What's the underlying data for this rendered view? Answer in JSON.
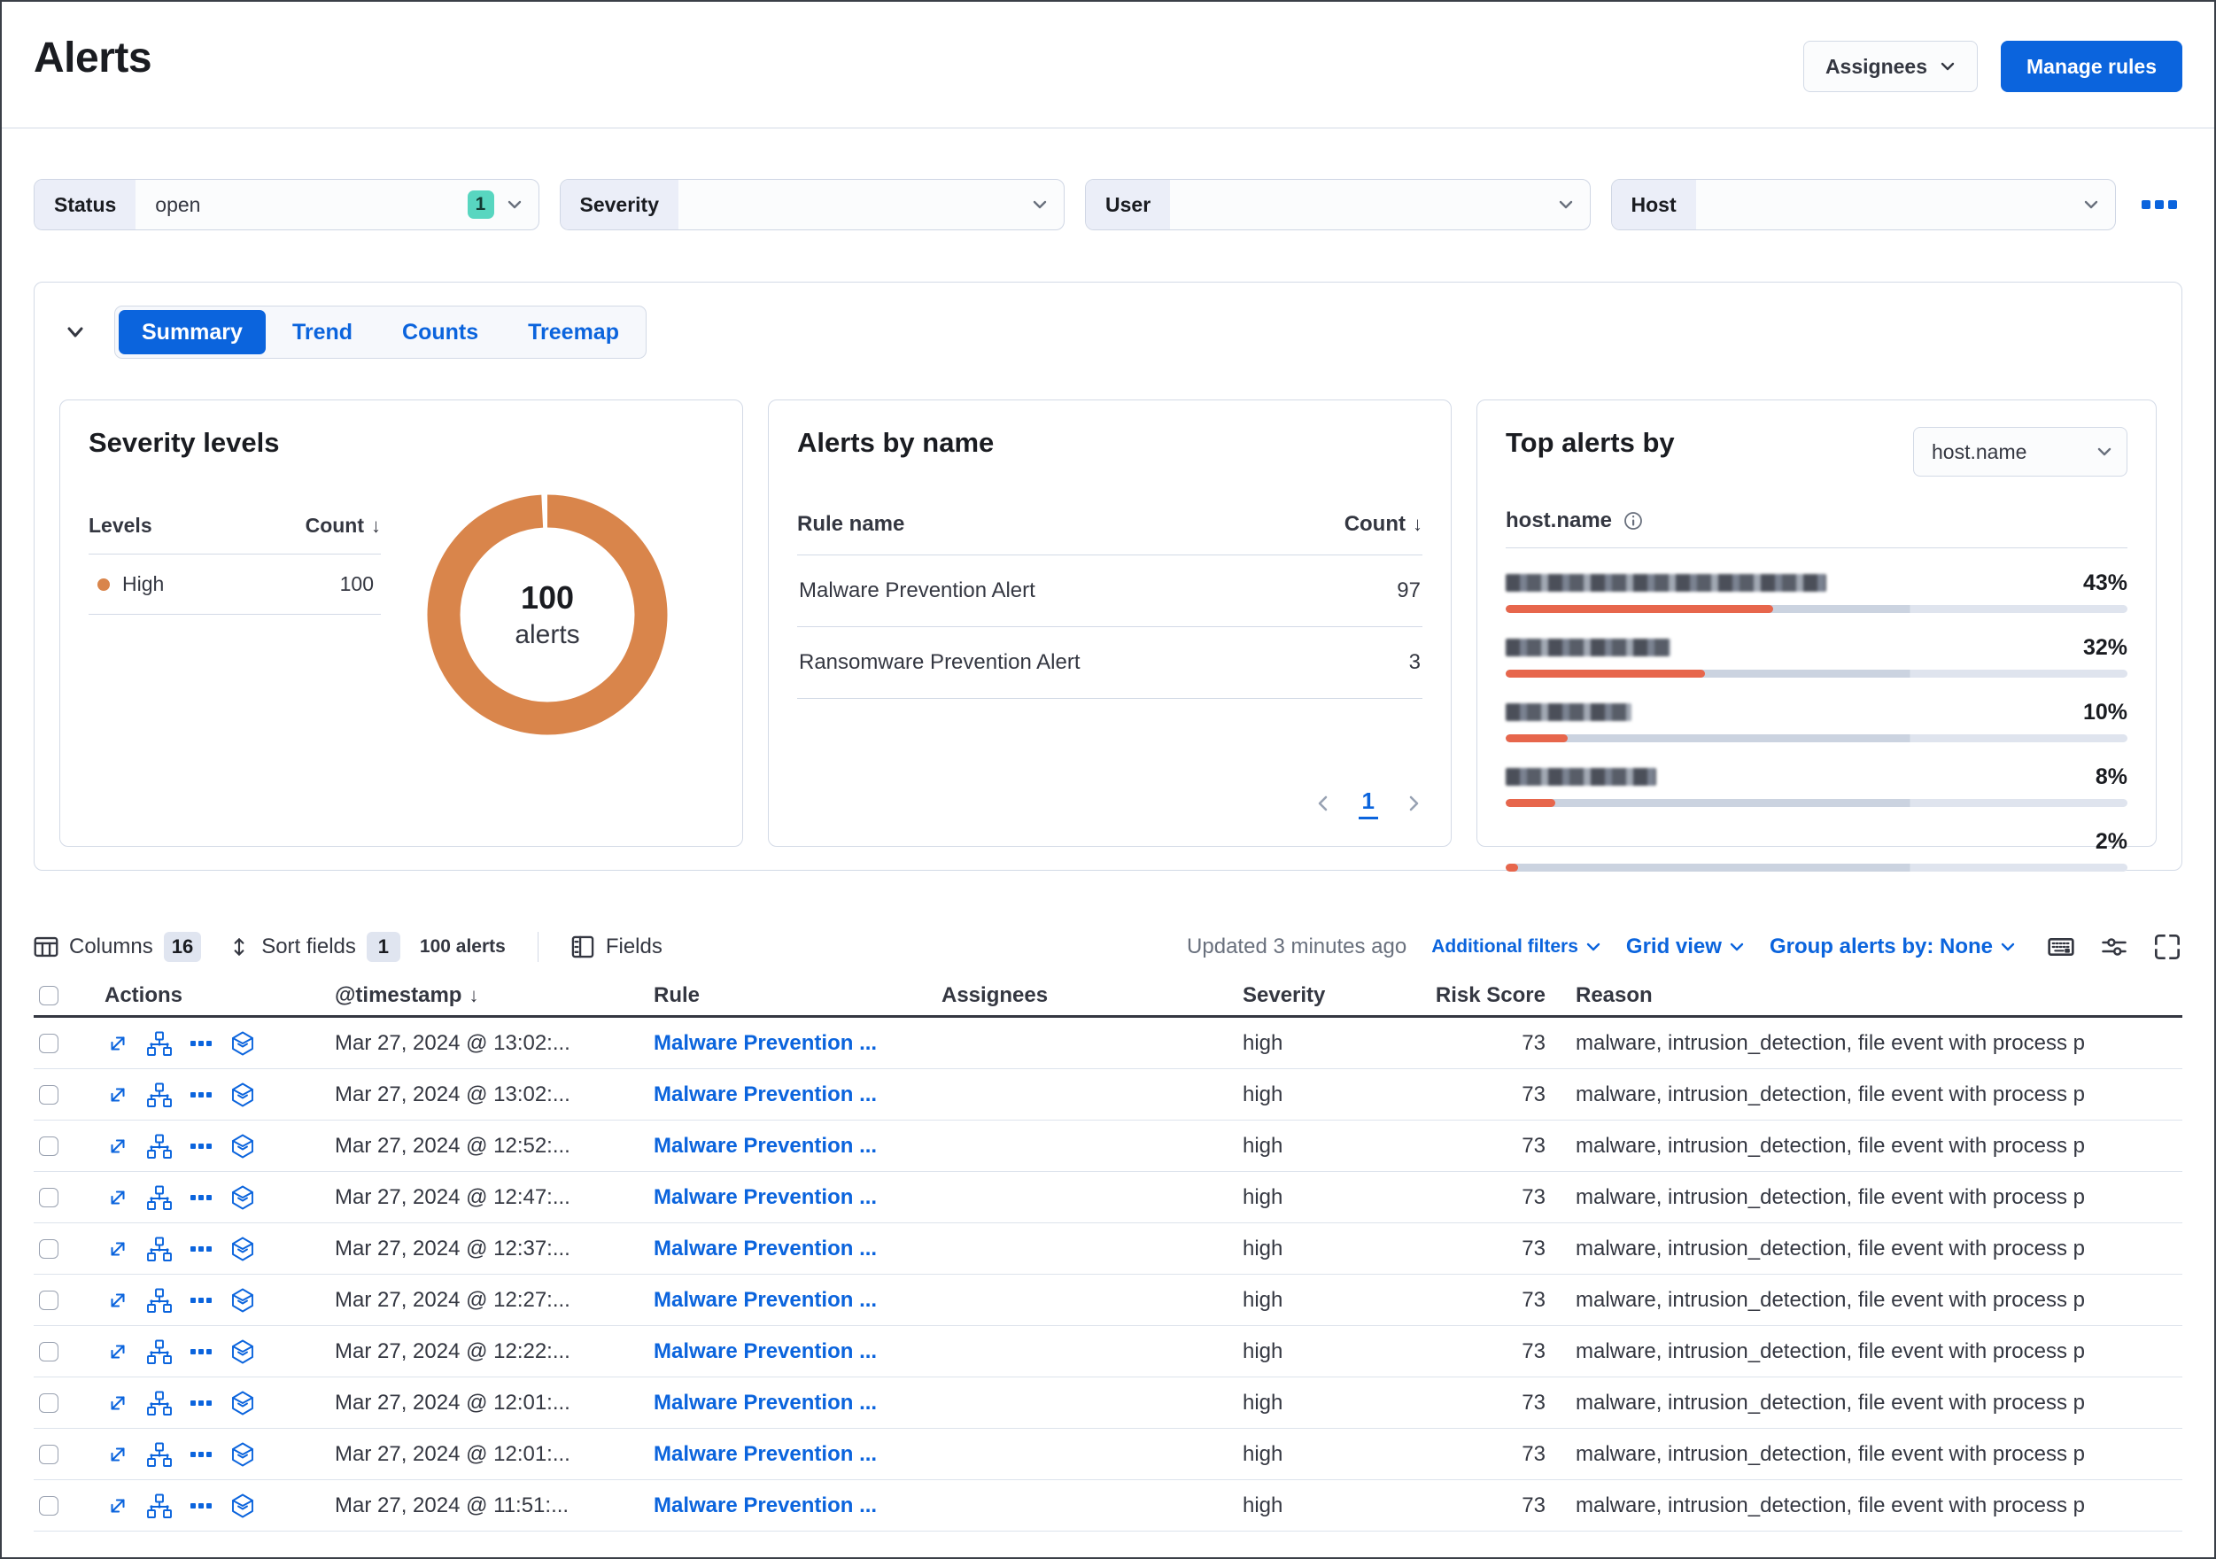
{
  "page": {
    "title": "Alerts"
  },
  "header": {
    "assignees_button": "Assignees",
    "manage_rules_button": "Manage rules"
  },
  "filters": {
    "status": {
      "label": "Status",
      "value": "open",
      "badge": "1"
    },
    "severity": {
      "label": "Severity",
      "value": ""
    },
    "user": {
      "label": "User",
      "value": ""
    },
    "host": {
      "label": "Host",
      "value": ""
    }
  },
  "kpi_tabs": {
    "summary": "Summary",
    "trend": "Trend",
    "counts": "Counts",
    "treemap": "Treemap"
  },
  "icons": {
    "sort_arrow": "↓"
  },
  "severity_panel": {
    "title": "Severity levels",
    "col_levels": "Levels",
    "col_count": "Count",
    "rows": [
      {
        "level": "High",
        "count": "100",
        "color": "#d9854b"
      }
    ],
    "donut": {
      "total": "100",
      "label": "alerts",
      "color": "#d9854b"
    }
  },
  "alerts_by_name_panel": {
    "title": "Alerts by name",
    "col_rule": "Rule name",
    "col_count": "Count",
    "rows": [
      {
        "rule": "Malware Prevention Alert",
        "count": "97"
      },
      {
        "rule": "Ransomware Prevention Alert",
        "count": "3"
      }
    ],
    "pagination": {
      "page": "1"
    }
  },
  "top_alerts_panel": {
    "title": "Top alerts by",
    "selector_value": "host.name",
    "field_label": "host.name",
    "bar_color": "#e7664c",
    "rows": [
      {
        "name": "[redacted host name]",
        "pct": "43%",
        "pct_value": 43
      },
      {
        "name": "[redacted host name]",
        "pct": "32%",
        "pct_value": 32
      },
      {
        "name": "[redacted host name]",
        "pct": "10%",
        "pct_value": 10
      },
      {
        "name": "[redacted host name]",
        "pct": "8%",
        "pct_value": 8
      },
      {
        "name": "[redacted host name]",
        "pct": "2%",
        "pct_value": 2
      }
    ]
  },
  "table_toolbar": {
    "columns_label": "Columns",
    "columns_count": "16",
    "sort_label": "Sort fields",
    "sort_count": "1",
    "alerts_count": "100 alerts",
    "fields_label": "Fields",
    "updated": "Updated 3 minutes ago",
    "additional_filters": "Additional filters",
    "grid_view": "Grid view",
    "group_by": "Group alerts by: None"
  },
  "table": {
    "headers": {
      "actions": "Actions",
      "timestamp": "@timestamp",
      "rule": "Rule",
      "assignees": "Assignees",
      "severity": "Severity",
      "risk_score": "Risk Score",
      "reason": "Reason"
    },
    "rows": [
      {
        "timestamp": "Mar 27, 2024 @ 13:02:...",
        "rule": "Malware Prevention ...",
        "assignees": "",
        "severity": "high",
        "risk": "73",
        "reason": "malware, intrusion_detection, file event with process p"
      },
      {
        "timestamp": "Mar 27, 2024 @ 13:02:...",
        "rule": "Malware Prevention ...",
        "assignees": "",
        "severity": "high",
        "risk": "73",
        "reason": "malware, intrusion_detection, file event with process p"
      },
      {
        "timestamp": "Mar 27, 2024 @ 12:52:...",
        "rule": "Malware Prevention ...",
        "assignees": "",
        "severity": "high",
        "risk": "73",
        "reason": "malware, intrusion_detection, file event with process p"
      },
      {
        "timestamp": "Mar 27, 2024 @ 12:47:...",
        "rule": "Malware Prevention ...",
        "assignees": "",
        "severity": "high",
        "risk": "73",
        "reason": "malware, intrusion_detection, file event with process p"
      },
      {
        "timestamp": "Mar 27, 2024 @ 12:37:...",
        "rule": "Malware Prevention ...",
        "assignees": "",
        "severity": "high",
        "risk": "73",
        "reason": "malware, intrusion_detection, file event with process p"
      },
      {
        "timestamp": "Mar 27, 2024 @ 12:27:...",
        "rule": "Malware Prevention ...",
        "assignees": "",
        "severity": "high",
        "risk": "73",
        "reason": "malware, intrusion_detection, file event with process p"
      },
      {
        "timestamp": "Mar 27, 2024 @ 12:22:...",
        "rule": "Malware Prevention ...",
        "assignees": "",
        "severity": "high",
        "risk": "73",
        "reason": "malware, intrusion_detection, file event with process p"
      },
      {
        "timestamp": "Mar 27, 2024 @ 12:01:...",
        "rule": "Malware Prevention ...",
        "assignees": "",
        "severity": "high",
        "risk": "73",
        "reason": "malware, intrusion_detection, file event with process p"
      },
      {
        "timestamp": "Mar 27, 2024 @ 12:01:...",
        "rule": "Malware Prevention ...",
        "assignees": "",
        "severity": "high",
        "risk": "73",
        "reason": "malware, intrusion_detection, file event with process p"
      },
      {
        "timestamp": "Mar 27, 2024 @ 11:51:...",
        "rule": "Malware Prevention ...",
        "assignees": "",
        "severity": "high",
        "risk": "73",
        "reason": "malware, intrusion_detection, file event with process p"
      }
    ]
  }
}
